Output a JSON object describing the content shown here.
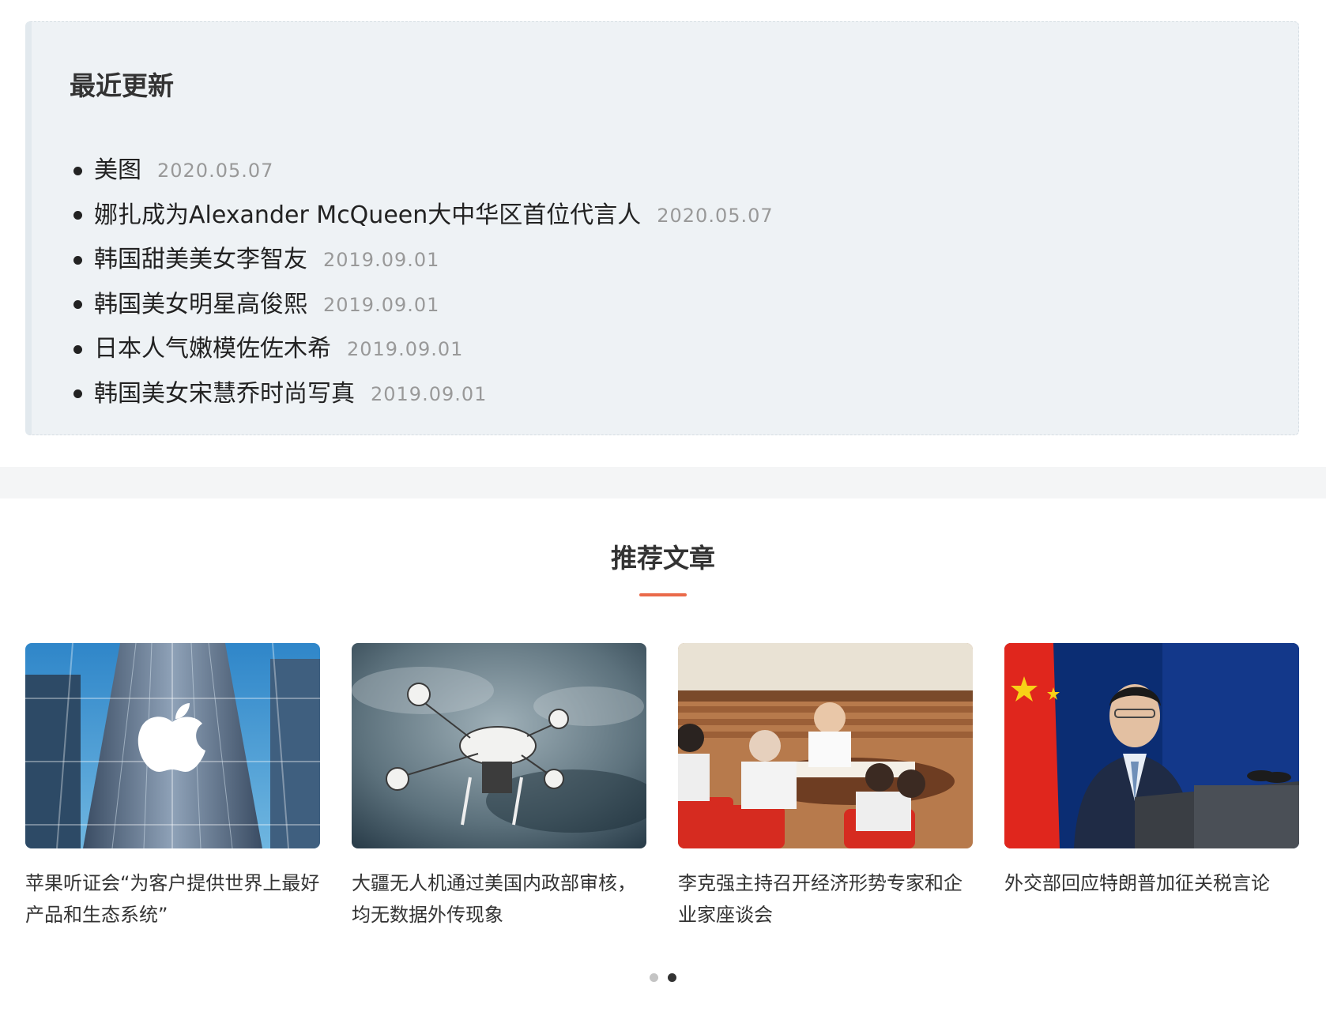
{
  "recent": {
    "title": "最近更新",
    "items": [
      {
        "label": "美图",
        "date": "2020.05.07"
      },
      {
        "label": "娜扎成为Alexander McQueen大中华区首位代言人",
        "date": "2020.05.07"
      },
      {
        "label": "韩国甜美美女李智友",
        "date": "2019.09.01"
      },
      {
        "label": "韩国美女明星高俊熙",
        "date": "2019.09.01"
      },
      {
        "label": "日本人气嫩模佐佐木希",
        "date": "2019.09.01"
      },
      {
        "label": "韩国美女宋慧乔时尚写真",
        "date": "2019.09.01"
      }
    ]
  },
  "recommend": {
    "heading": "推荐文章",
    "accent_color": "#ea6a4a",
    "cards": [
      {
        "title": "苹果听证会“为客户提供世界上最好产品和生态系统”",
        "image": "apple-store-photo"
      },
      {
        "title": "大疆无人机通过美国内政部审核，均无数据外传现象",
        "image": "drone-photo"
      },
      {
        "title": "李克强主持召开经济形势专家和企业家座谈会",
        "image": "meeting-photo"
      },
      {
        "title": "外交部回应特朗普加征关税言论",
        "image": "press-conference-photo"
      }
    ],
    "carousel": {
      "pages": 2,
      "active_page": 2
    }
  }
}
